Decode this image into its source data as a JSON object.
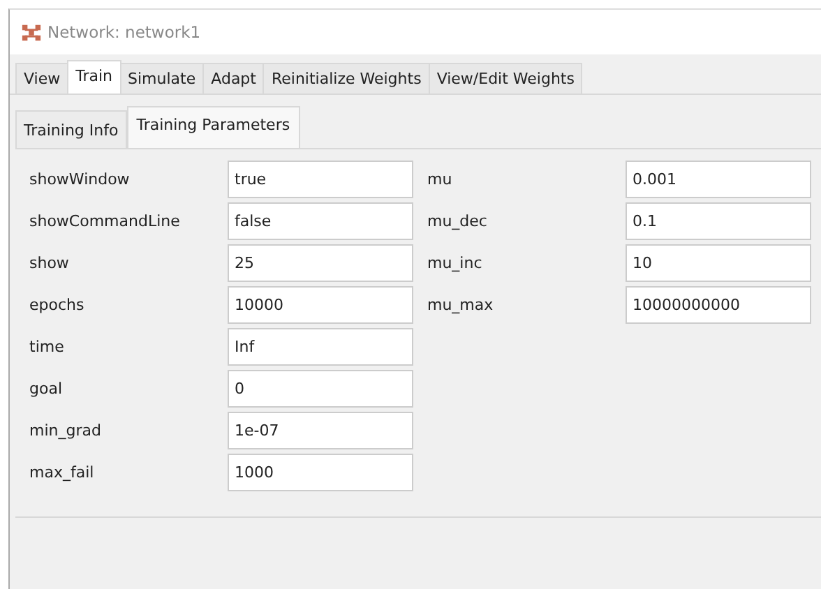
{
  "window": {
    "title": "Network: network1"
  },
  "tabs": [
    {
      "label": "View",
      "selected": false
    },
    {
      "label": "Train",
      "selected": true
    },
    {
      "label": "Simulate",
      "selected": false
    },
    {
      "label": "Adapt",
      "selected": false
    },
    {
      "label": "Reinitialize Weights",
      "selected": false
    },
    {
      "label": "View/Edit Weights",
      "selected": false
    }
  ],
  "subtabs": [
    {
      "label": "Training Info",
      "selected": false
    },
    {
      "label": "Training Parameters",
      "selected": true
    }
  ],
  "parameter_columns": [
    [
      {
        "name": "showWindow",
        "value": "true"
      },
      {
        "name": "showCommandLine",
        "value": "false"
      },
      {
        "name": "show",
        "value": "25"
      },
      {
        "name": "epochs",
        "value": "10000"
      },
      {
        "name": "time",
        "value": "Inf"
      },
      {
        "name": "goal",
        "value": "0"
      },
      {
        "name": "min_grad",
        "value": "1e-07"
      },
      {
        "name": "max_fail",
        "value": "1000"
      }
    ],
    [
      {
        "name": "mu",
        "value": "0.001"
      },
      {
        "name": "mu_dec",
        "value": "0.1"
      },
      {
        "name": "mu_inc",
        "value": "10"
      },
      {
        "name": "mu_max",
        "value": "10000000000"
      }
    ]
  ]
}
